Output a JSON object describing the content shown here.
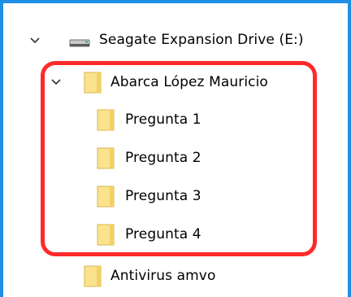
{
  "tree": {
    "drive": {
      "label": "Seagate Expansion Drive (E:)",
      "icon": "drive-icon",
      "expanded": true
    },
    "folder_main": {
      "label": "Abarca López Mauricio",
      "icon": "folder-icon",
      "expanded": true,
      "children": [
        {
          "label": "Pregunta 1",
          "icon": "folder-icon"
        },
        {
          "label": "Pregunta 2",
          "icon": "folder-icon"
        },
        {
          "label": "Pregunta 3",
          "icon": "folder-icon"
        },
        {
          "label": "Pregunta 4",
          "icon": "folder-icon"
        }
      ]
    },
    "folder_other": {
      "label": "Antivirus amvo",
      "icon": "folder-icon"
    }
  },
  "colors": {
    "frame_border": "#1e8fe6",
    "highlight_border": "#ff2a2a",
    "folder_fill": "#fbe38e",
    "folder_stroke": "#d9b64a"
  }
}
